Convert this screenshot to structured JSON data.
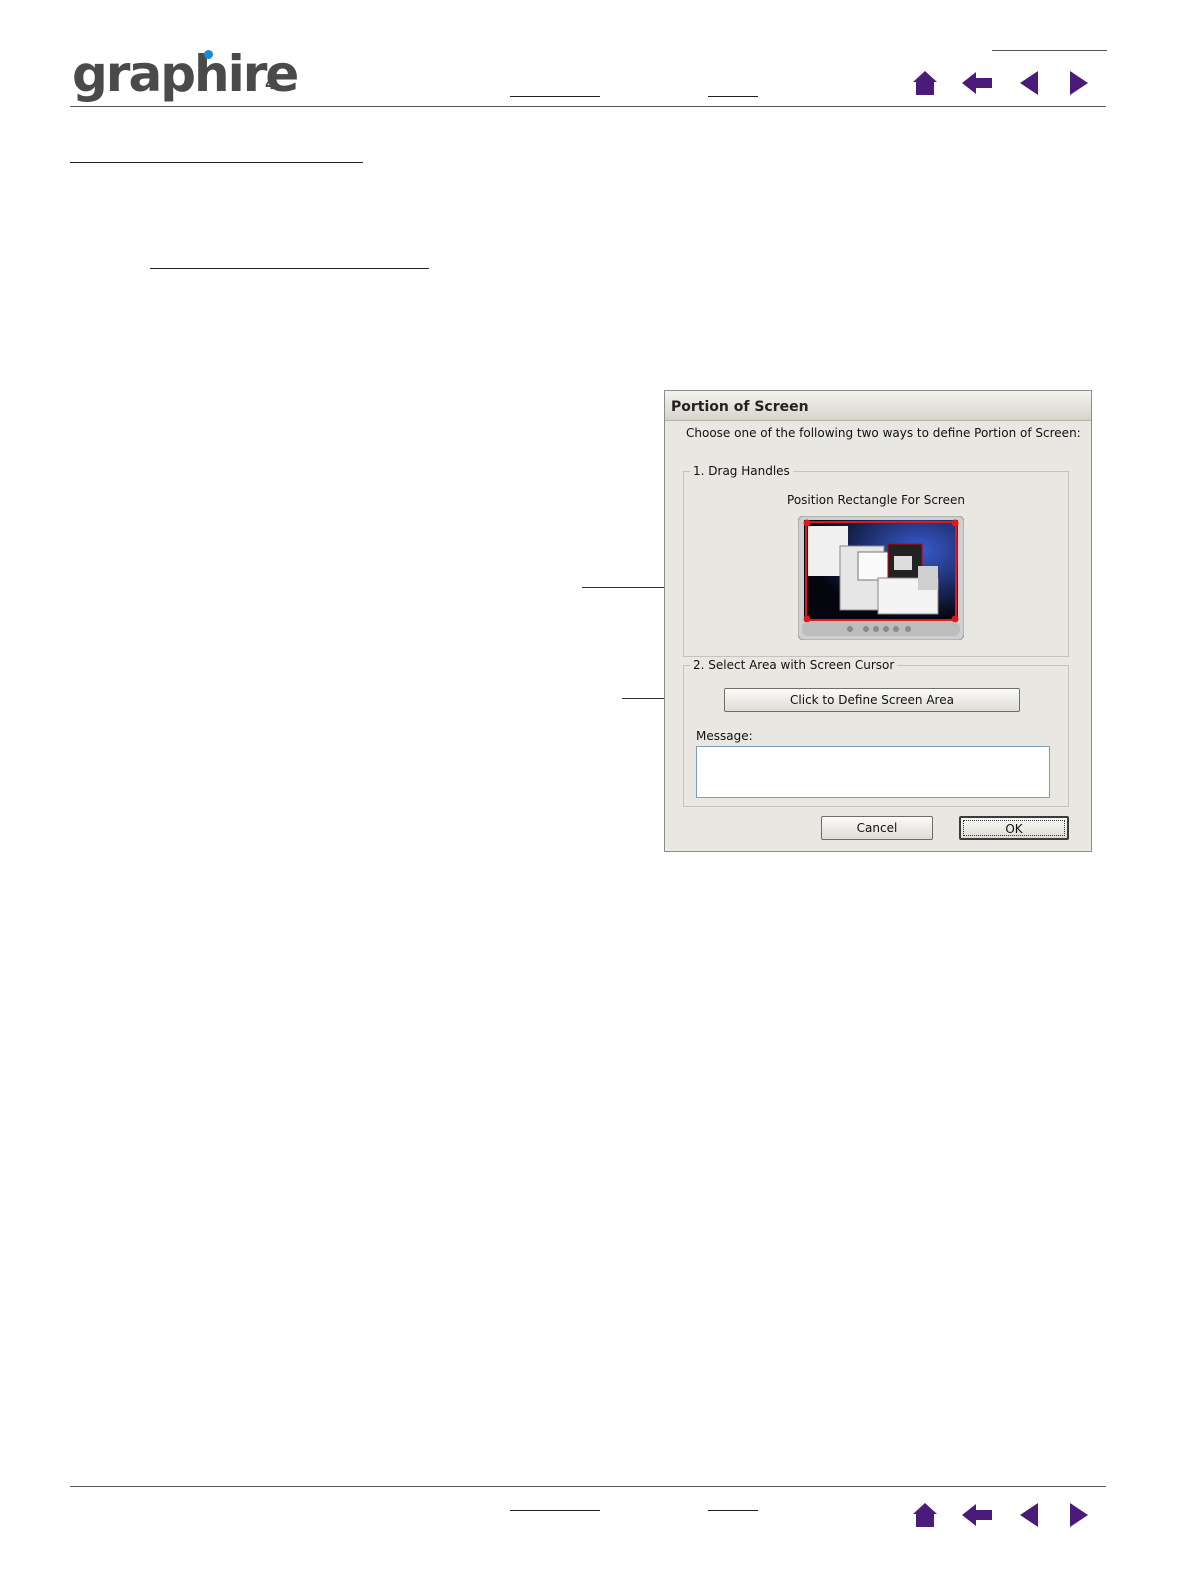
{
  "header": {
    "logo_text": "graphire",
    "logo_superscript": "4"
  },
  "nav_icons": [
    "home-icon",
    "back-arrow-icon",
    "previous-page-icon",
    "next-page-icon"
  ],
  "dialog": {
    "title": "Portion of Screen",
    "instruction": "Choose one of the following two ways to define Portion of Screen:",
    "group1_label": "1. Drag Handles",
    "group1_caption": "Position Rectangle For Screen",
    "group2_label": "2. Select Area with Screen Cursor",
    "define_button": "Click to Define Screen Area",
    "message_label": "Message:",
    "message_value": "",
    "cancel_button": "Cancel",
    "ok_button": "OK"
  },
  "colors": {
    "nav_icon": "#4b1b7a",
    "logo_accent": "#1a8ad4",
    "handle": "#e01818"
  }
}
